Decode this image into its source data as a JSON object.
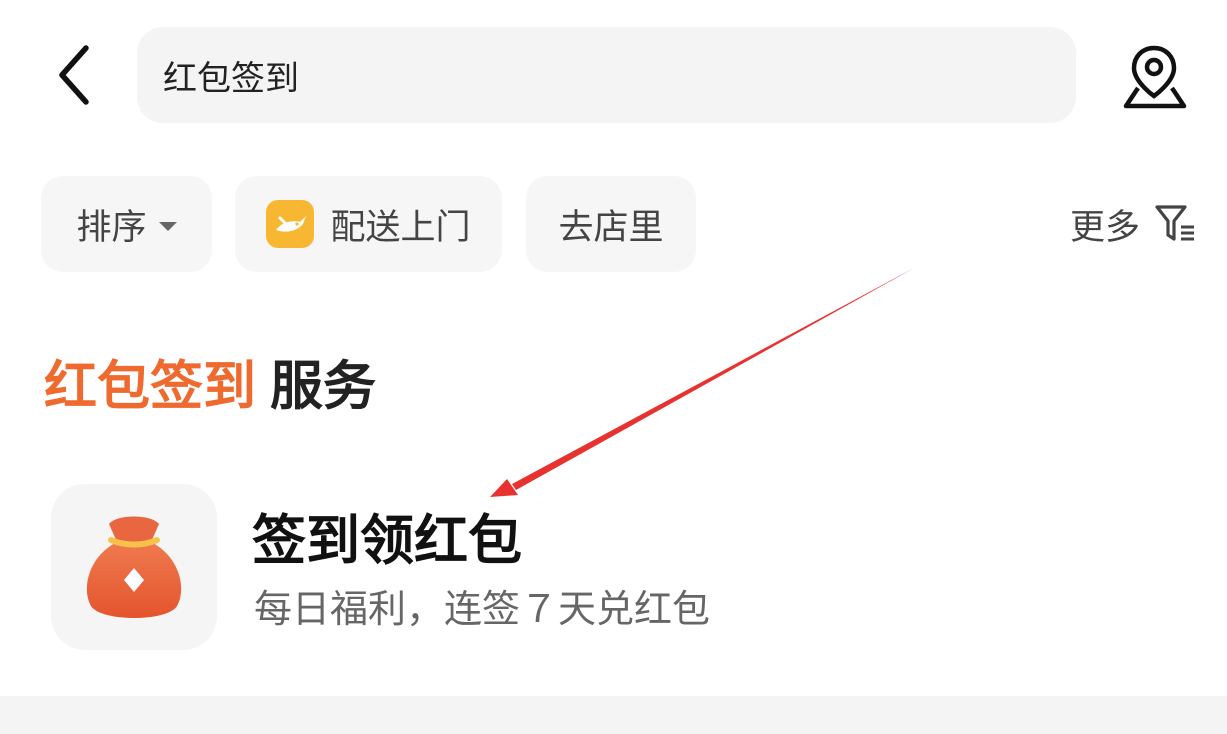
{
  "search": {
    "value": "红包签到",
    "back_icon": "chevron-left-icon",
    "location_icon": "location-pin-icon"
  },
  "filters": {
    "sort_label": "排序",
    "delivery_label": "配送上门",
    "delivery_icon": "delivery-rabbit-icon",
    "store_label": "去店里",
    "more_label": "更多",
    "filter_icon": "filter-funnel-icon"
  },
  "section": {
    "keyword": "红包签到",
    "suffix": "服务"
  },
  "service": {
    "name": "签到领红包",
    "description": "每日福利，连签７天兑红包",
    "icon": "money-bag-icon"
  },
  "colors": {
    "accent": "#ee6a2e",
    "annotation_arrow": "#e8322f",
    "chip_bg": "#f6f6f6"
  }
}
